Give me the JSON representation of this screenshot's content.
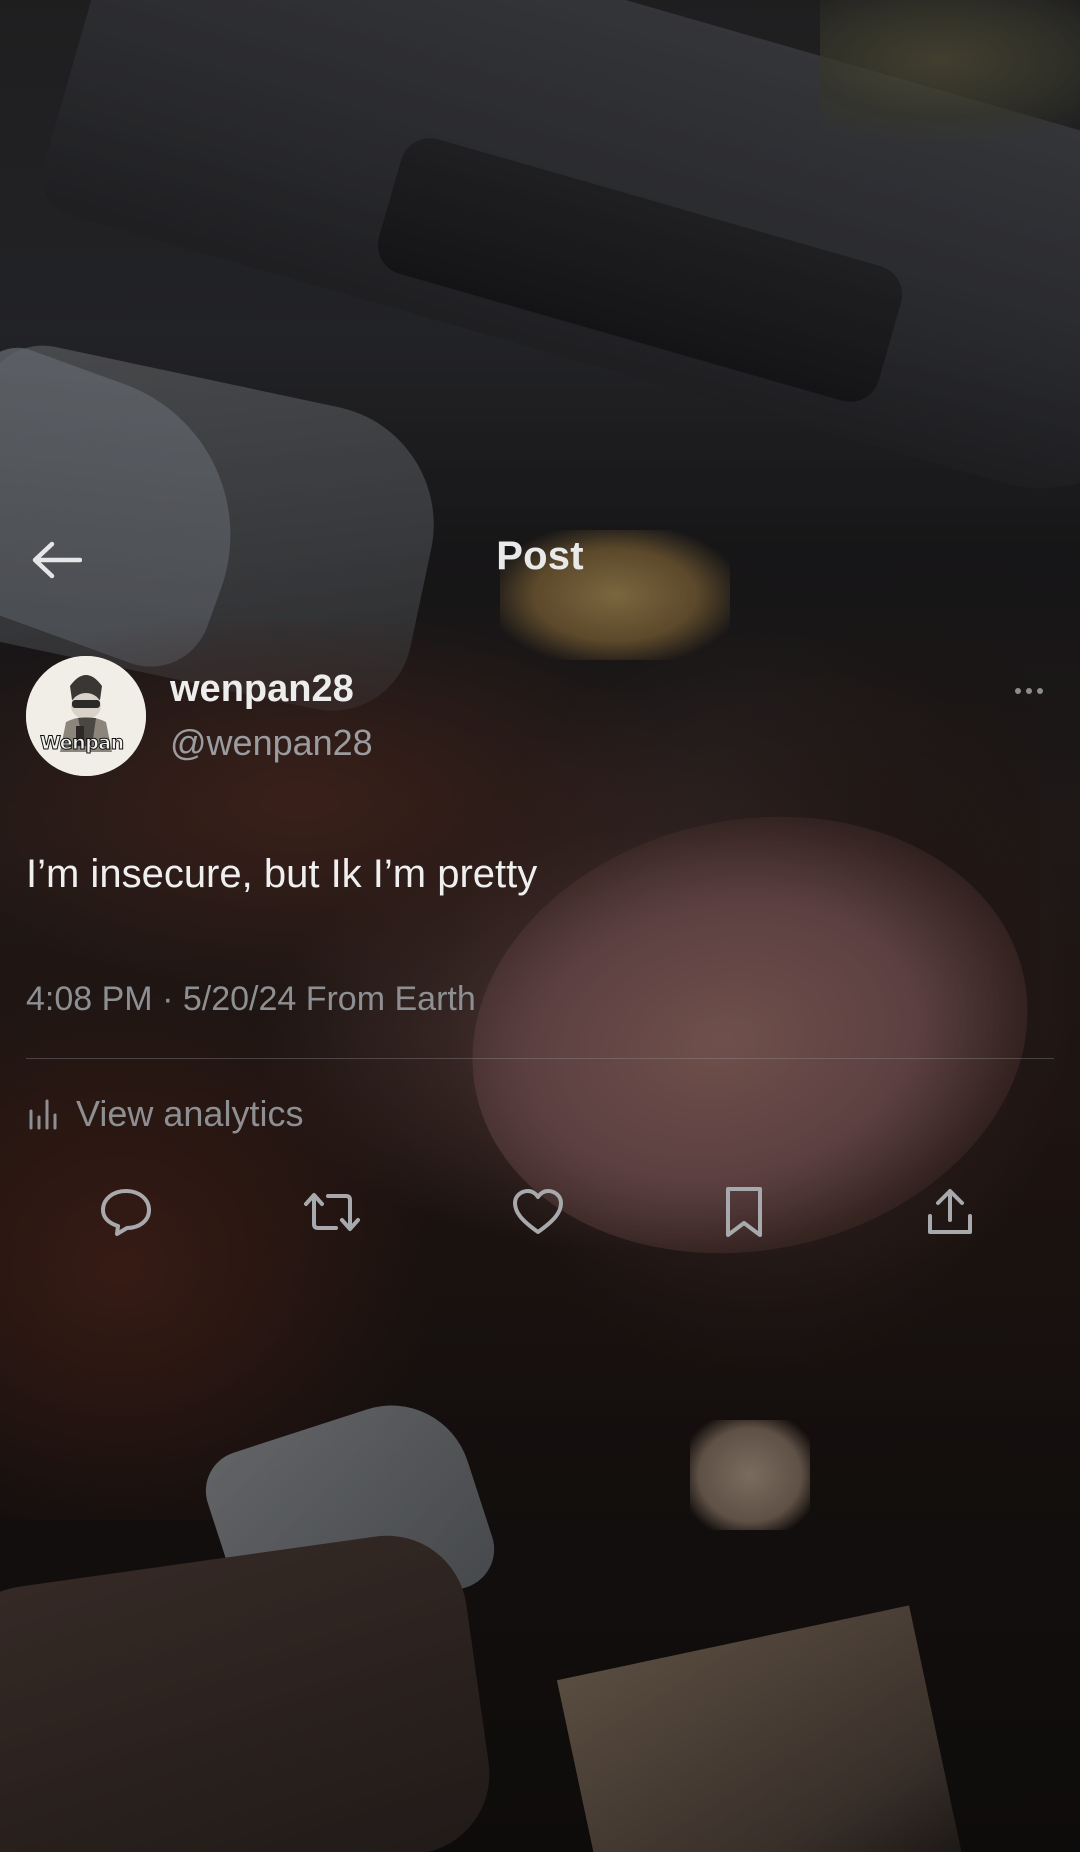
{
  "header": {
    "title": "Post"
  },
  "author": {
    "display_name": "wenpan28",
    "handle": "@wenpan28",
    "avatar_text": "Wenpan"
  },
  "post": {
    "text": "I’m insecure, but Ik I’m pretty",
    "meta": "4:08 PM · 5/20/24 From Earth"
  },
  "analytics": {
    "label": "View analytics"
  },
  "actions": [
    {
      "icon": "reply-icon"
    },
    {
      "icon": "repost-icon"
    },
    {
      "icon": "like-icon"
    },
    {
      "icon": "bookmark-icon"
    },
    {
      "icon": "share-icon"
    }
  ],
  "colors": {
    "text_primary": "#ededed",
    "text_secondary": "#8e8f93",
    "icon": "#a8a9ad"
  }
}
